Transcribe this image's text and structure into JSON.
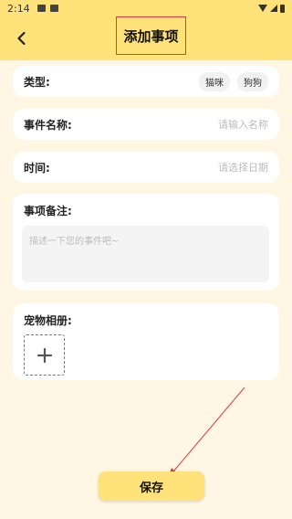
{
  "status_bar": {
    "time": "2:14"
  },
  "header": {
    "title": "添加事项",
    "back_icon": "chevron-left-icon"
  },
  "type_row": {
    "label": "类型:",
    "options": [
      "猫咪",
      "狗狗"
    ]
  },
  "event_name": {
    "label": "事件名称:",
    "placeholder": "请输入名称"
  },
  "time_row": {
    "label": "时间:",
    "placeholder": "请选择日期"
  },
  "notes": {
    "label": "事项备注:",
    "placeholder": "描述一下您的事件吧~"
  },
  "album": {
    "label": "宠物相册:",
    "add_icon": "plus-icon"
  },
  "save": {
    "label": "保存"
  },
  "colors": {
    "accent": "#ffe27a",
    "background": "#fff7e3",
    "annotation": "#e53935"
  }
}
